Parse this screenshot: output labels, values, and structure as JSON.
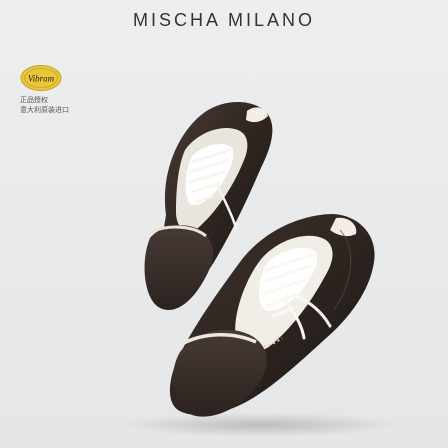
{
  "brand": {
    "name": "MISCHA MILANO"
  },
  "badge": {
    "label": "Vibram"
  },
  "caption": {
    "line1": "正品授权",
    "line2": "意大利原装进口"
  },
  "colors": {
    "background": "#eceeef",
    "leather_dark": "#2e2521",
    "suede_dark": "#3a2f2b",
    "lace_cream": "#f1eee7",
    "badge_yellow": "#e9c73a"
  },
  "icons": {
    "badge": "vibram-logo-icon"
  }
}
